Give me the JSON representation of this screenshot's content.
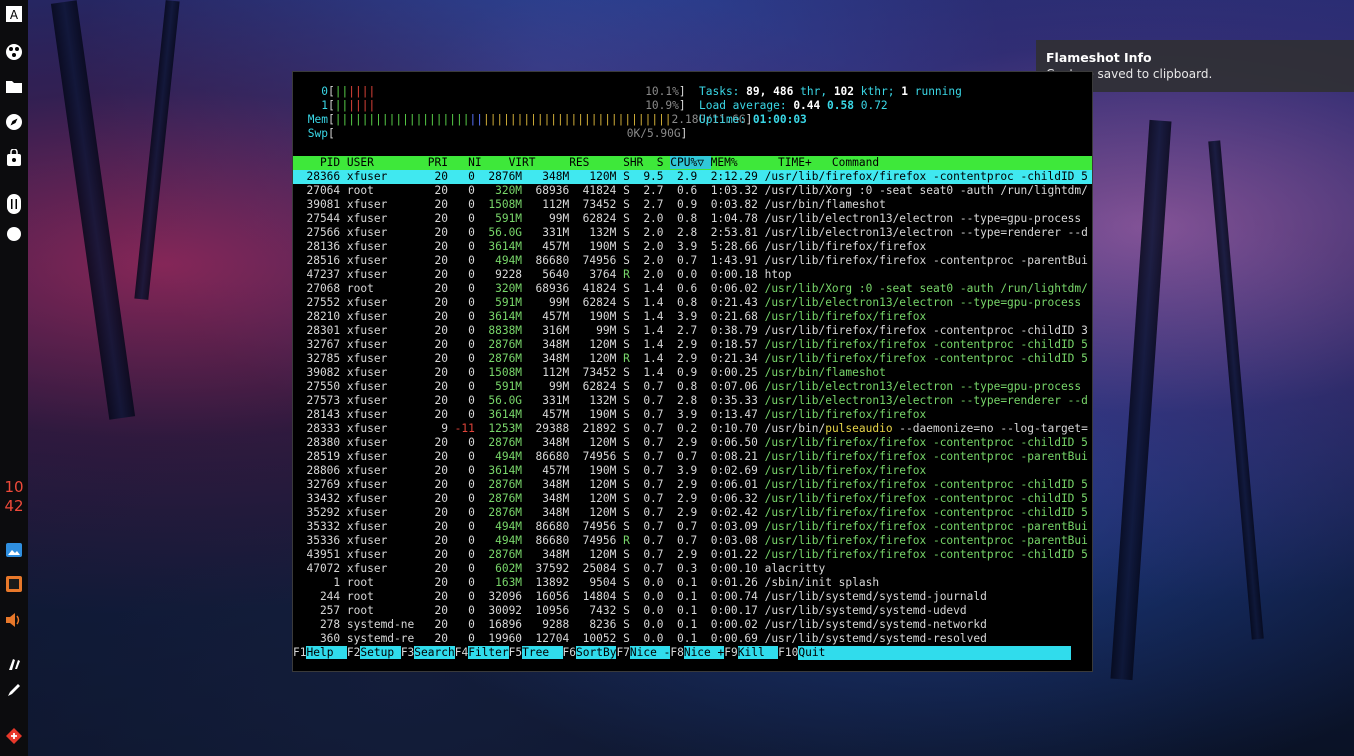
{
  "notification": {
    "title": "Flameshot Info",
    "body": "Capture saved to clipboard."
  },
  "dock": {
    "clock_hour": "10",
    "clock_minute": "42",
    "items": [
      "font-icon",
      "palette-icon",
      "folder-icon",
      "compass-icon",
      "bag-icon",
      "slider-icon",
      "toggle-icon",
      "image-icon",
      "photos-icon",
      "volume-icon",
      "brush-icon",
      "pen-icon",
      "network-icon"
    ]
  },
  "htop": {
    "meters": {
      "cpu0": {
        "label": "0",
        "percent": "10.1%",
        "bar": "||||||"
      },
      "cpu1": {
        "label": "1",
        "percent": "10.9%",
        "bar": "||||||"
      },
      "mem": {
        "label": "Mem",
        "value": "2.18G/11.6G",
        "bar": "||||||||||||||||||||||||||||||||||||||||||||||||||"
      },
      "swp": {
        "label": "Swp",
        "value": "0K/5.90G"
      },
      "tasks_label": "Tasks:",
      "tasks": "89,",
      "thr": "486",
      "thr_label": "thr,",
      "kthr": "102",
      "kthr_label": "kthr;",
      "running": "1",
      "running_label": "running",
      "load_label": "Load average:",
      "load1": "0.44",
      "load5": "0.58",
      "load15": "0.72",
      "uptime_label": "Uptime:",
      "uptime": "01:00:03"
    },
    "header": [
      "PID",
      "USER",
      "PRI",
      "NI",
      "VIRT",
      "RES",
      "SHR",
      "S",
      "CPU%▽",
      "MEM%",
      "TIME+",
      "Command"
    ],
    "processes": [
      [
        "28366",
        "xfuser",
        "20",
        "0",
        "2876M",
        "348M",
        "120M",
        "S",
        "9.5",
        "2.9",
        "2:12.29",
        "/usr/lib/firefox/firefox -contentproc -childID 5"
      ],
      [
        "27064",
        "root",
        "20",
        "0",
        "320M",
        "68936",
        "41824",
        "S",
        "2.7",
        "0.6",
        "1:03.32",
        "/usr/lib/Xorg :0 -seat seat0 -auth /run/lightdm/"
      ],
      [
        "39081",
        "xfuser",
        "20",
        "0",
        "1508M",
        "112M",
        "73452",
        "S",
        "2.7",
        "0.9",
        "0:03.82",
        "/usr/bin/flameshot"
      ],
      [
        "27544",
        "xfuser",
        "20",
        "0",
        "591M",
        "99M",
        "62824",
        "S",
        "2.0",
        "0.8",
        "1:04.78",
        "/usr/lib/electron13/electron --type=gpu-process"
      ],
      [
        "27566",
        "xfuser",
        "20",
        "0",
        "56.0G",
        "331M",
        "132M",
        "S",
        "2.0",
        "2.8",
        "2:53.81",
        "/usr/lib/electron13/electron --type=renderer --d"
      ],
      [
        "28136",
        "xfuser",
        "20",
        "0",
        "3614M",
        "457M",
        "190M",
        "S",
        "2.0",
        "3.9",
        "5:28.66",
        "/usr/lib/firefox/firefox"
      ],
      [
        "28516",
        "xfuser",
        "20",
        "0",
        "494M",
        "86680",
        "74956",
        "S",
        "2.0",
        "0.7",
        "1:43.91",
        "/usr/lib/firefox/firefox -contentproc -parentBui"
      ],
      [
        "47237",
        "xfuser",
        "20",
        "0",
        "9228",
        "5640",
        "3764",
        "R",
        "2.0",
        "0.0",
        "0:00.18",
        "htop"
      ],
      [
        "27068",
        "root",
        "20",
        "0",
        "320M",
        "68936",
        "41824",
        "S",
        "1.4",
        "0.6",
        "0:06.02",
        "/usr/lib/Xorg :0 -seat seat0 -auth /run/lightdm/"
      ],
      [
        "27552",
        "xfuser",
        "20",
        "0",
        "591M",
        "99M",
        "62824",
        "S",
        "1.4",
        "0.8",
        "0:21.43",
        "/usr/lib/electron13/electron --type=gpu-process"
      ],
      [
        "28210",
        "xfuser",
        "20",
        "0",
        "3614M",
        "457M",
        "190M",
        "S",
        "1.4",
        "3.9",
        "0:21.68",
        "/usr/lib/firefox/firefox"
      ],
      [
        "28301",
        "xfuser",
        "20",
        "0",
        "8838M",
        "316M",
        "99M",
        "S",
        "1.4",
        "2.7",
        "0:38.79",
        "/usr/lib/firefox/firefox -contentproc -childID 3"
      ],
      [
        "32767",
        "xfuser",
        "20",
        "0",
        "2876M",
        "348M",
        "120M",
        "S",
        "1.4",
        "2.9",
        "0:18.57",
        "/usr/lib/firefox/firefox -contentproc -childID 5"
      ],
      [
        "32785",
        "xfuser",
        "20",
        "0",
        "2876M",
        "348M",
        "120M",
        "R",
        "1.4",
        "2.9",
        "0:21.34",
        "/usr/lib/firefox/firefox -contentproc -childID 5"
      ],
      [
        "39082",
        "xfuser",
        "20",
        "0",
        "1508M",
        "112M",
        "73452",
        "S",
        "1.4",
        "0.9",
        "0:00.25",
        "/usr/bin/flameshot"
      ],
      [
        "27550",
        "xfuser",
        "20",
        "0",
        "591M",
        "99M",
        "62824",
        "S",
        "0.7",
        "0.8",
        "0:07.06",
        "/usr/lib/electron13/electron --type=gpu-process"
      ],
      [
        "27573",
        "xfuser",
        "20",
        "0",
        "56.0G",
        "331M",
        "132M",
        "S",
        "0.7",
        "2.8",
        "0:35.33",
        "/usr/lib/electron13/electron --type=renderer --d"
      ],
      [
        "28143",
        "xfuser",
        "20",
        "0",
        "3614M",
        "457M",
        "190M",
        "S",
        "0.7",
        "3.9",
        "0:13.47",
        "/usr/lib/firefox/firefox"
      ],
      [
        "28333",
        "xfuser",
        "9",
        "-11",
        "1253M",
        "29388",
        "21892",
        "S",
        "0.7",
        "0.2",
        "0:10.70",
        "/usr/bin/pulseaudio --daemonize=no --log-target="
      ],
      [
        "28380",
        "xfuser",
        "20",
        "0",
        "2876M",
        "348M",
        "120M",
        "S",
        "0.7",
        "2.9",
        "0:06.50",
        "/usr/lib/firefox/firefox -contentproc -childID 5"
      ],
      [
        "28519",
        "xfuser",
        "20",
        "0",
        "494M",
        "86680",
        "74956",
        "S",
        "0.7",
        "0.7",
        "0:08.21",
        "/usr/lib/firefox/firefox -contentproc -parentBui"
      ],
      [
        "28806",
        "xfuser",
        "20",
        "0",
        "3614M",
        "457M",
        "190M",
        "S",
        "0.7",
        "3.9",
        "0:02.69",
        "/usr/lib/firefox/firefox"
      ],
      [
        "32769",
        "xfuser",
        "20",
        "0",
        "2876M",
        "348M",
        "120M",
        "S",
        "0.7",
        "2.9",
        "0:06.01",
        "/usr/lib/firefox/firefox -contentproc -childID 5"
      ],
      [
        "33432",
        "xfuser",
        "20",
        "0",
        "2876M",
        "348M",
        "120M",
        "S",
        "0.7",
        "2.9",
        "0:06.32",
        "/usr/lib/firefox/firefox -contentproc -childID 5"
      ],
      [
        "35292",
        "xfuser",
        "20",
        "0",
        "2876M",
        "348M",
        "120M",
        "S",
        "0.7",
        "2.9",
        "0:02.42",
        "/usr/lib/firefox/firefox -contentproc -childID 5"
      ],
      [
        "35332",
        "xfuser",
        "20",
        "0",
        "494M",
        "86680",
        "74956",
        "S",
        "0.7",
        "0.7",
        "0:03.09",
        "/usr/lib/firefox/firefox -contentproc -parentBui"
      ],
      [
        "35336",
        "xfuser",
        "20",
        "0",
        "494M",
        "86680",
        "74956",
        "R",
        "0.7",
        "0.7",
        "0:03.08",
        "/usr/lib/firefox/firefox -contentproc -parentBui"
      ],
      [
        "43951",
        "xfuser",
        "20",
        "0",
        "2876M",
        "348M",
        "120M",
        "S",
        "0.7",
        "2.9",
        "0:01.22",
        "/usr/lib/firefox/firefox -contentproc -childID 5"
      ],
      [
        "47072",
        "xfuser",
        "20",
        "0",
        "602M",
        "37592",
        "25084",
        "S",
        "0.7",
        "0.3",
        "0:00.10",
        "alacritty"
      ],
      [
        "1",
        "root",
        "20",
        "0",
        "163M",
        "13892",
        "9504",
        "S",
        "0.0",
        "0.1",
        "0:01.26",
        "/sbin/init splash"
      ],
      [
        "244",
        "root",
        "20",
        "0",
        "32096",
        "16056",
        "14804",
        "S",
        "0.0",
        "0.1",
        "0:00.74",
        "/usr/lib/systemd/systemd-journald"
      ],
      [
        "257",
        "root",
        "20",
        "0",
        "30092",
        "10956",
        "7432",
        "S",
        "0.0",
        "0.1",
        "0:00.17",
        "/usr/lib/systemd/systemd-udevd"
      ],
      [
        "278",
        "systemd-ne",
        "20",
        "0",
        "16896",
        "9288",
        "8236",
        "S",
        "0.0",
        "0.1",
        "0:00.02",
        "/usr/lib/systemd/systemd-networkd"
      ],
      [
        "360",
        "systemd-re",
        "20",
        "0",
        "19960",
        "12704",
        "10052",
        "S",
        "0.0",
        "0.1",
        "0:00.69",
        "/usr/lib/systemd/systemd-resolved"
      ]
    ],
    "thread_rows": [
      8,
      9,
      10,
      12,
      13,
      14,
      15,
      16,
      17,
      19,
      20,
      21,
      22,
      23,
      24,
      25,
      26,
      27
    ],
    "selected_row": 0,
    "function_keys": [
      {
        "key": "F1",
        "label": "Help  "
      },
      {
        "key": "F2",
        "label": "Setup "
      },
      {
        "key": "F3",
        "label": "Search"
      },
      {
        "key": "F4",
        "label": "Filter"
      },
      {
        "key": "F5",
        "label": "Tree  "
      },
      {
        "key": "F6",
        "label": "SortBy"
      },
      {
        "key": "F7",
        "label": "Nice -"
      },
      {
        "key": "F8",
        "label": "Nice +"
      },
      {
        "key": "F9",
        "label": "Kill  "
      },
      {
        "key": "F10",
        "label": "Quit"
      }
    ]
  }
}
